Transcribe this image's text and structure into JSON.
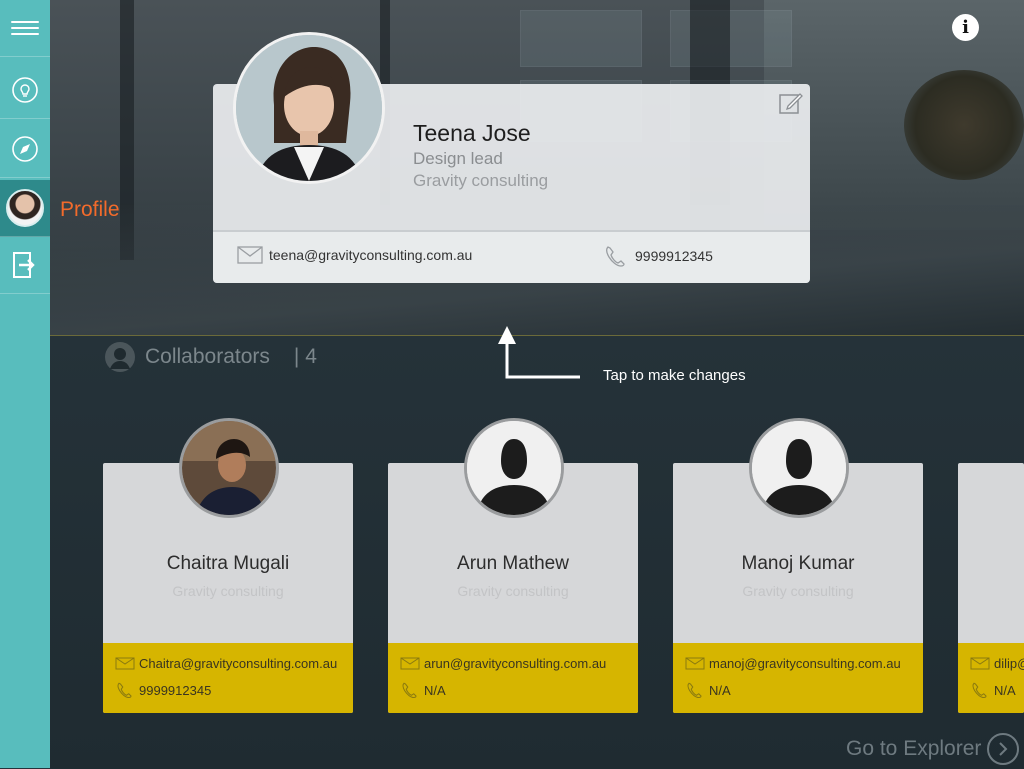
{
  "sidebar": {
    "items": [
      {
        "name": "menu",
        "icon": "hamburger-menu-icon"
      },
      {
        "name": "ideas",
        "icon": "lightbulb-icon"
      },
      {
        "name": "explore",
        "icon": "compass-icon"
      },
      {
        "name": "profile",
        "icon": "avatar",
        "label": "Profile",
        "active": true
      },
      {
        "name": "logout",
        "icon": "logout-icon"
      }
    ]
  },
  "profile": {
    "name": "Teena Jose",
    "role": "Design lead",
    "company": "Gravity consulting",
    "email": "teena@gravityconsulting.com.au",
    "phone": "9999912345"
  },
  "hint": {
    "text": "Tap to make changes"
  },
  "collaborators": {
    "title": "Collaborators",
    "count": "| 4",
    "items": [
      {
        "name": "Chaitra Mugali",
        "company": "Gravity consulting",
        "email": "Chaitra@gravityconsulting.com.au",
        "phone": "9999912345",
        "avatar": "photo"
      },
      {
        "name": "Arun Mathew",
        "company": "Gravity consulting",
        "email": "arun@gravityconsulting.com.au",
        "phone": "N/A",
        "avatar": "silhouette"
      },
      {
        "name": "Manoj Kumar",
        "company": "Gravity consulting",
        "email": "manoj@gravityconsulting.com.au",
        "phone": "N/A",
        "avatar": "silhouette"
      },
      {
        "name": "",
        "company": "",
        "email": "dilip@",
        "phone": "N/A",
        "avatar": "silhouette"
      }
    ]
  },
  "go_explorer": {
    "label": "Go to Explorer"
  },
  "colors": {
    "sidebar": "#58bdbd",
    "sidebar_active": "#2e8a8b",
    "accent_orange": "#f36b2b",
    "card_yellow": "#d6b500"
  }
}
